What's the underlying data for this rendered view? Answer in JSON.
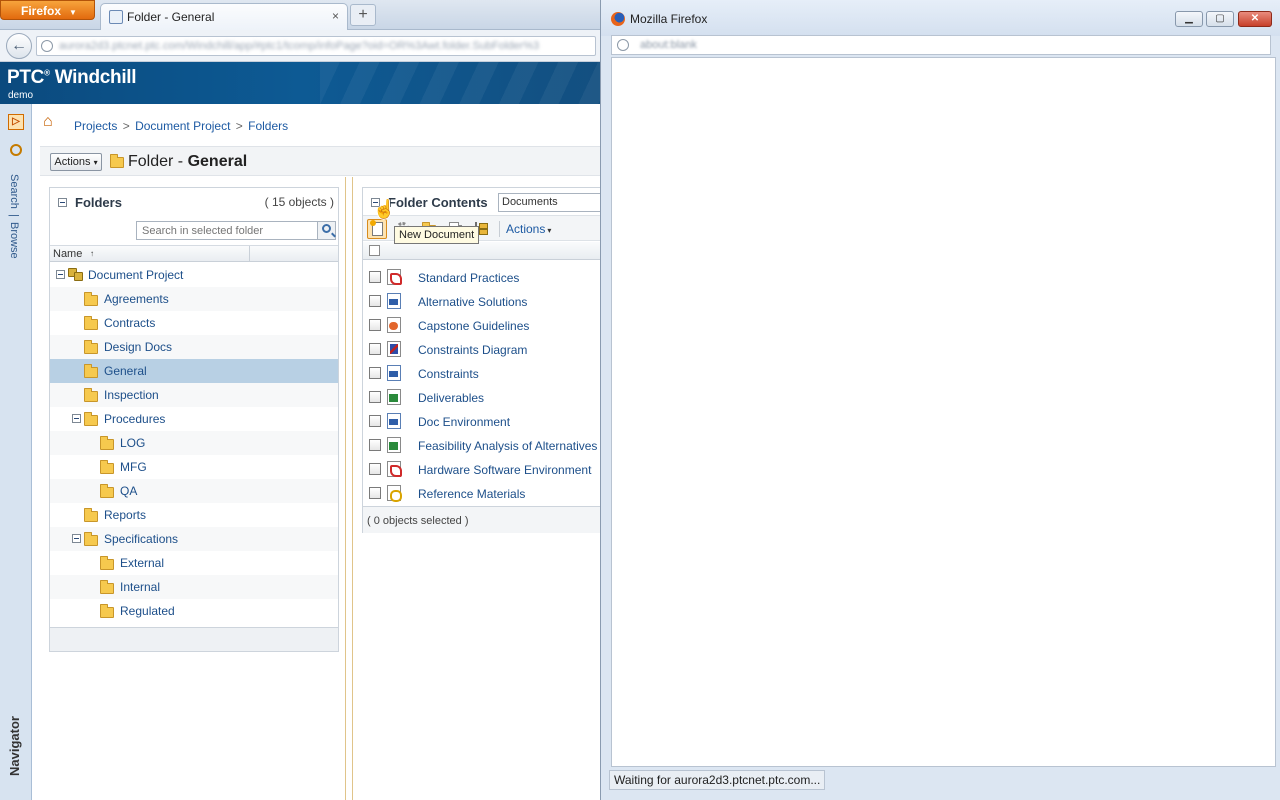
{
  "browser": {
    "menu_button": "Firefox",
    "tab_title": "Folder - General",
    "tab_close": "×",
    "new_tab": "+",
    "back": "←",
    "url": "aurora2d3.ptcnet.ptc.com/Windchill/app/#ptc1/tcomp/infoPage?oid=OR%3Awt.folder.SubFolder%3"
  },
  "app": {
    "logo": "PTC",
    "logo_mark": "®",
    "product": "Windchill",
    "subtitle": "demo",
    "rail": {
      "toggle": "▷",
      "search": "Search",
      "divider": "|",
      "browse": "Browse",
      "navigator": "Navigator"
    }
  },
  "breadcrumb": {
    "home": "⌂",
    "items": [
      "Projects",
      "Document Project",
      "Folders"
    ],
    "separator": ">"
  },
  "page": {
    "actions_label": "Actions",
    "actions_caret": "▾",
    "title_prefix": "Folder - ",
    "title_name": "General"
  },
  "folders_pane": {
    "title": "Folders",
    "count": "( 15 objects )",
    "search_placeholder": "Search in selected folder",
    "column_name": "Name",
    "sort_indicator": "↑",
    "tree": [
      {
        "label": "Document Project",
        "level": 0,
        "expanded": true,
        "type": "project"
      },
      {
        "label": "Agreements",
        "level": 1
      },
      {
        "label": "Contracts",
        "level": 1
      },
      {
        "label": "Design Docs",
        "level": 1
      },
      {
        "label": "General",
        "level": 1,
        "selected": true
      },
      {
        "label": "Inspection",
        "level": 1
      },
      {
        "label": "Procedures",
        "level": 1,
        "expanded": true
      },
      {
        "label": "LOG",
        "level": 2
      },
      {
        "label": "MFG",
        "level": 2
      },
      {
        "label": "QA",
        "level": 2
      },
      {
        "label": "Reports",
        "level": 1
      },
      {
        "label": "Specifications",
        "level": 1,
        "expanded": true
      },
      {
        "label": "External",
        "level": 2
      },
      {
        "label": "Internal",
        "level": 2
      },
      {
        "label": "Regulated",
        "level": 2
      }
    ]
  },
  "contents_pane": {
    "title": "Folder Contents",
    "view": "Documents",
    "toolbar_actions": "Actions",
    "toolbar_caret": "▾",
    "tooltip": "New Document",
    "cursor": "☝",
    "documents": [
      {
        "label": "Standard Practices",
        "icon": "pdf"
      },
      {
        "label": "Alternative Solutions",
        "icon": "word"
      },
      {
        "label": "Capstone Guidelines",
        "icon": "ppt"
      },
      {
        "label": "Constraints Diagram",
        "icon": "drawing"
      },
      {
        "label": "Constraints",
        "icon": "word"
      },
      {
        "label": "Deliverables",
        "icon": "excel"
      },
      {
        "label": "Doc Environment",
        "icon": "word"
      },
      {
        "label": "Feasibility Analysis of Alternatives",
        "icon": "excel"
      },
      {
        "label": "Hardware Software Environment",
        "icon": "pdf"
      },
      {
        "label": "Reference Materials",
        "icon": "gear"
      }
    ],
    "selection_status": "( 0 objects selected )"
  },
  "popup": {
    "title": "Mozilla Firefox",
    "url": "about:blank",
    "minimize": "▁",
    "maximize": "▢",
    "close": "✕",
    "status": "Waiting for aurora2d3.ptcnet.ptc.com..."
  }
}
